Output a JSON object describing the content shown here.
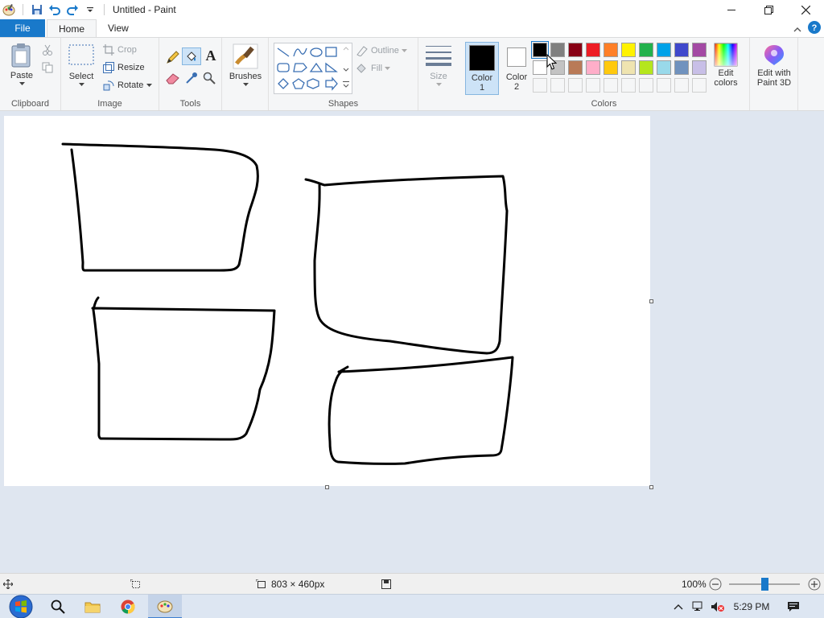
{
  "window": {
    "title": "Untitled - Paint"
  },
  "tabs": {
    "file": "File",
    "home": "Home",
    "view": "View"
  },
  "ribbon": {
    "clipboard": {
      "label": "Clipboard",
      "paste": "Paste"
    },
    "image": {
      "label": "Image",
      "select": "Select",
      "crop": "Crop",
      "resize": "Resize",
      "rotate": "Rotate"
    },
    "tools": {
      "label": "Tools"
    },
    "brushes": {
      "label": "Brushes"
    },
    "shapes": {
      "label": "Shapes",
      "outline": "Outline",
      "fill": "Fill"
    },
    "size": {
      "label": "Size"
    },
    "colors": {
      "label": "Colors",
      "color1": "Color",
      "color1_num": "1",
      "color2": "Color",
      "color2_num": "2",
      "edit_colors_1": "Edit",
      "edit_colors_2": "colors",
      "edit_3d_1": "Edit with",
      "edit_3d_2": "Paint 3D",
      "color1_value": "#000000",
      "color2_value": "#ffffff",
      "palette_row1": [
        "#000000",
        "#7f7f7f",
        "#880015",
        "#ed1c24",
        "#ff7f27",
        "#fff200",
        "#22b14c",
        "#00a2e8",
        "#3f48cc",
        "#a349a4"
      ],
      "palette_row2": [
        "#ffffff",
        "#c3c3c3",
        "#b97a57",
        "#ffaec9",
        "#ffc90e",
        "#efe4b0",
        "#b5e61d",
        "#99d9ea",
        "#7092be",
        "#c8bfe7"
      ]
    }
  },
  "status": {
    "dimensions": "803 × 460px",
    "zoom": "100%",
    "zoom_level_percent": 100
  },
  "taskbar": {
    "clock": "5:29 PM"
  }
}
